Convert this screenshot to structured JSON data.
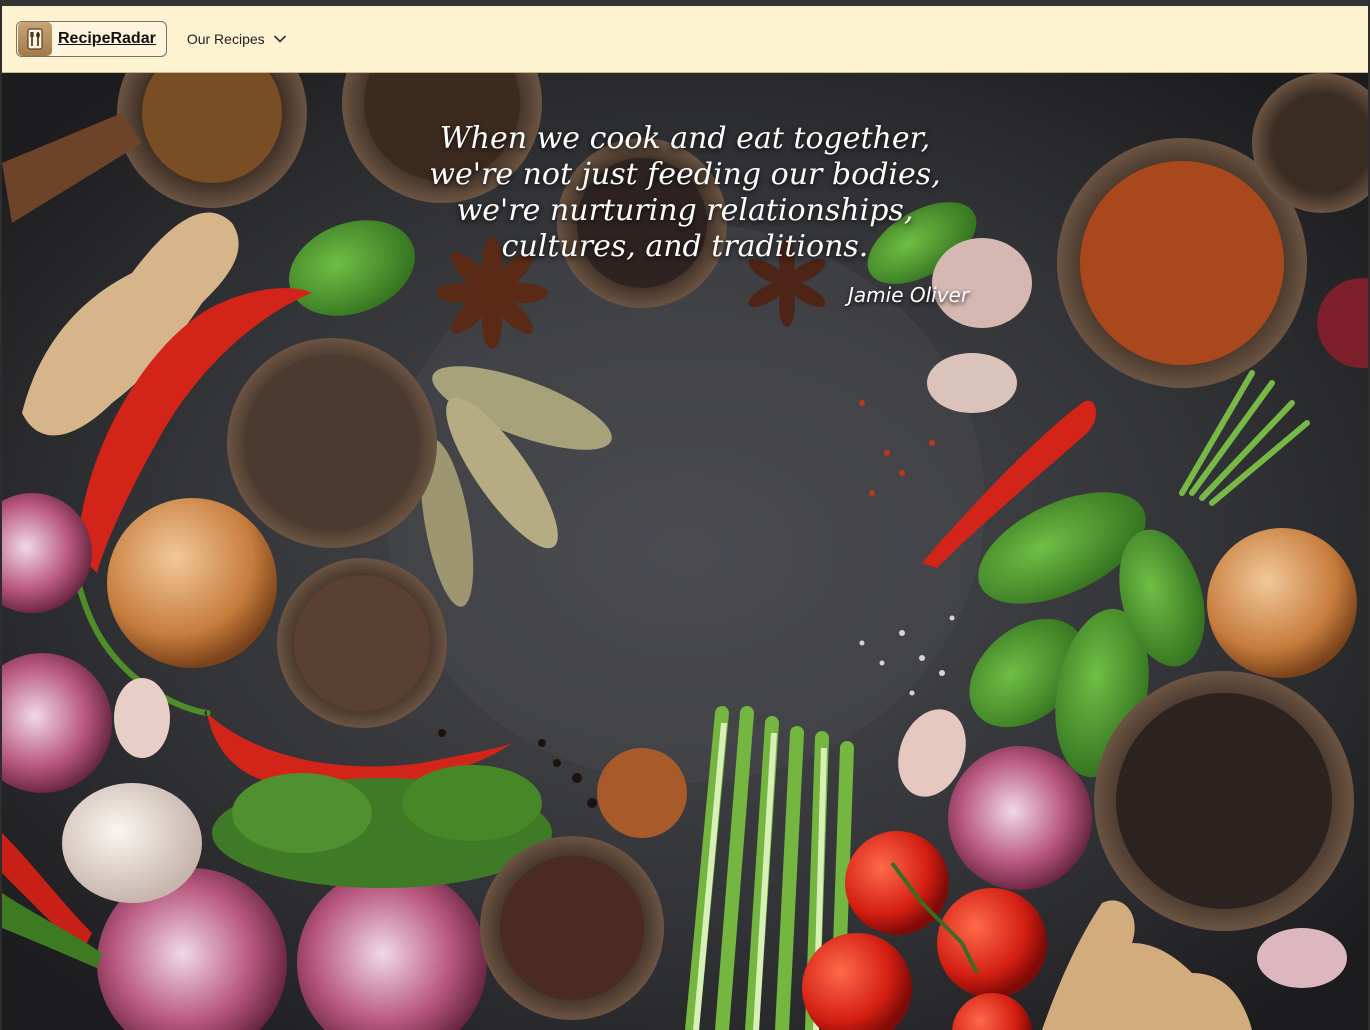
{
  "nav": {
    "brand": "RecipeRadar",
    "menu_label": "Our Recipes"
  },
  "hero": {
    "quote_lines": [
      "When we cook and eat together,",
      "we're not just feeding our bodies,",
      "we're nurturing relationships,",
      "cultures, and traditions."
    ],
    "author": "Jamie Oliver"
  },
  "icons": {
    "logo": "kitchen-utensils-icon",
    "menu": "chevron-down-icon"
  },
  "colors": {
    "navbar_bg": "#fdf3d0",
    "hero_bg": "#2f3033"
  }
}
